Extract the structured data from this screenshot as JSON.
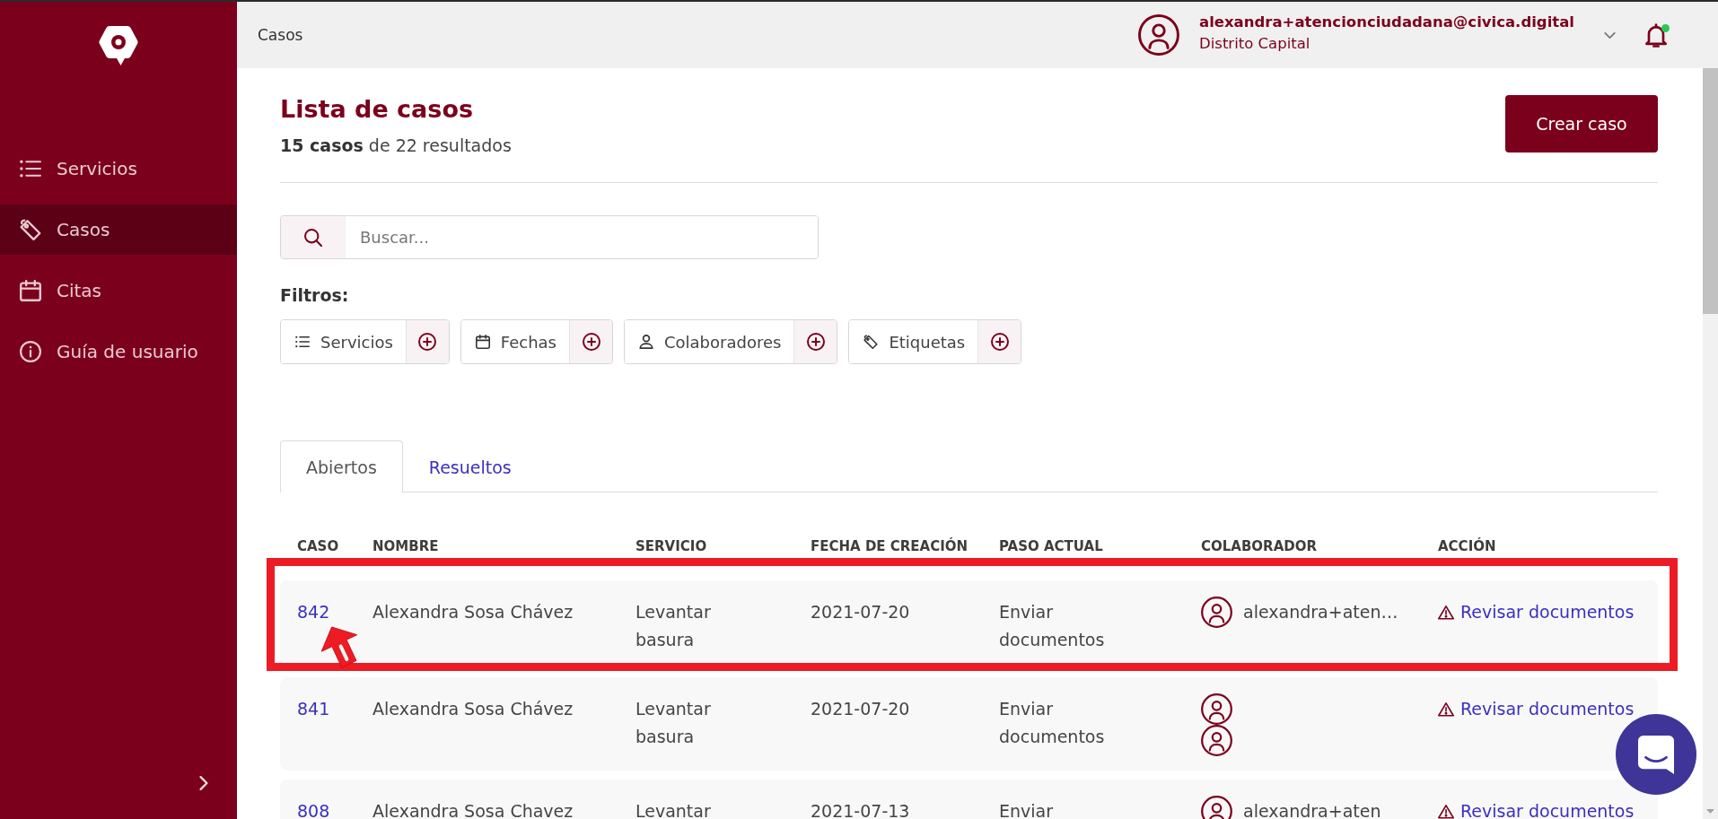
{
  "sidebar": {
    "items": [
      {
        "label": "Servicios",
        "selected": false
      },
      {
        "label": "Casos",
        "selected": true
      },
      {
        "label": "Citas",
        "selected": false
      },
      {
        "label": "Guía de usuario",
        "selected": false
      }
    ]
  },
  "header": {
    "breadcrumb": "Casos",
    "user": {
      "email": "alexandra+atencionciudadana@civica.digital",
      "organization": "Distrito Capital"
    },
    "notifications": {
      "unread": true
    }
  },
  "page": {
    "title": "Lista de casos",
    "summary": "**15 casos** de 22 resultados",
    "create_button": "Crear caso"
  },
  "search": {
    "placeholder": "Buscar..."
  },
  "filters": {
    "label": "Filtros:",
    "items": [
      {
        "label": "Servicios"
      },
      {
        "label": "Fechas"
      },
      {
        "label": "Colaboradores"
      },
      {
        "label": "Etiquetas"
      }
    ]
  },
  "tabs": [
    {
      "label": "Abiertos",
      "selected": true
    },
    {
      "label": "Resueltos",
      "selected": false
    }
  ],
  "table": {
    "columns": [
      "CASO",
      "NOMBRE",
      "SERVICIO",
      "FECHA DE CREACIÓN",
      "PASO ACTUAL",
      "COLABORADOR",
      "ACCIÓN"
    ],
    "rows": [
      {
        "case": "842",
        "name": "Alexandra Sosa Chávez",
        "service": "Levantar basura",
        "created": "2021-07-20",
        "step": "Enviar documentos",
        "collaborators": [
          {
            "avatar": true,
            "name": "alexandra+aten…"
          }
        ],
        "action": "Revisar documentos",
        "highlighted": true
      },
      {
        "case": "841",
        "name": "Alexandra Sosa Chávez",
        "service": "Levantar basura",
        "created": "2021-07-20",
        "step": "Enviar documentos",
        "collaborators": [
          {
            "avatar": true
          },
          {
            "avatar": true
          }
        ],
        "action": "Revisar documentos",
        "highlighted": false
      },
      {
        "case": "808",
        "name": "Alexandra Sosa Chavez",
        "service": "Levantar",
        "created": "2021-07-13",
        "step": "Enviar",
        "collaborators": [
          {
            "avatar": true,
            "name": "alexandra+aten"
          }
        ],
        "action": "Revisar documentos",
        "highlighted": false
      }
    ]
  }
}
